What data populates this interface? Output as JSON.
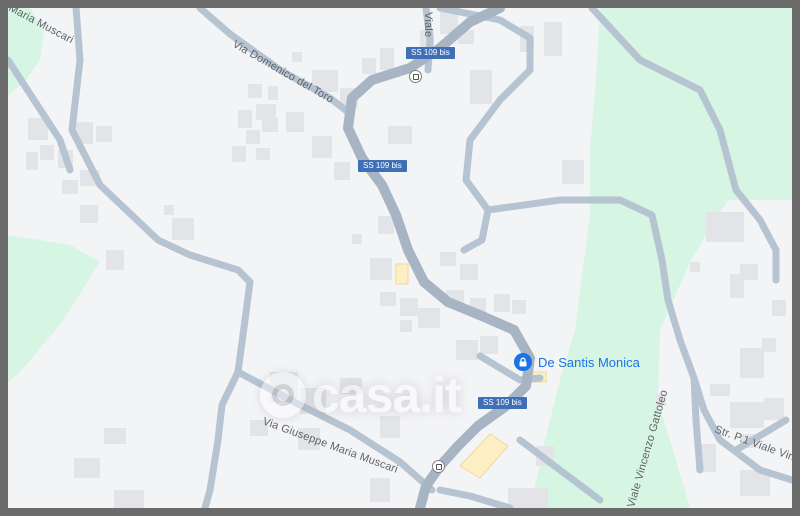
{
  "map": {
    "streets": {
      "domenico_del_toro": "Via Domenico del Toro",
      "viale_top": "Viale",
      "maria_muscari_top": "Maria Muscari",
      "giuseppe_maria_muscari": "Via Giuseppe Maria Muscari",
      "viale_vincenzo_gattoleo": "Viale Vincenzo Gattoleo",
      "str_p1_viale_vin": "Str. P.1 Viale Vin"
    },
    "road_shields": [
      "SS 109 bis",
      "SS 109 bis",
      "SS 109 bis"
    ],
    "poi": {
      "label": "De Santis Monica",
      "icon": "real-estate-agency-pin-icon"
    },
    "transit_icons": [
      "bus-stop-icon",
      "bus-stop-icon"
    ],
    "watermark": {
      "text": "casa.it",
      "icon": "casa-logo-icon"
    },
    "colors": {
      "land": "#f3f4f6",
      "park": "#d7f5e3",
      "road": "#b6c4d2",
      "building": "#e2e4e8",
      "highlight_building": "#fcefc4",
      "shield": "#3f6fb6",
      "poi": "#1a73e8",
      "frame": "#6b6b6b"
    }
  }
}
